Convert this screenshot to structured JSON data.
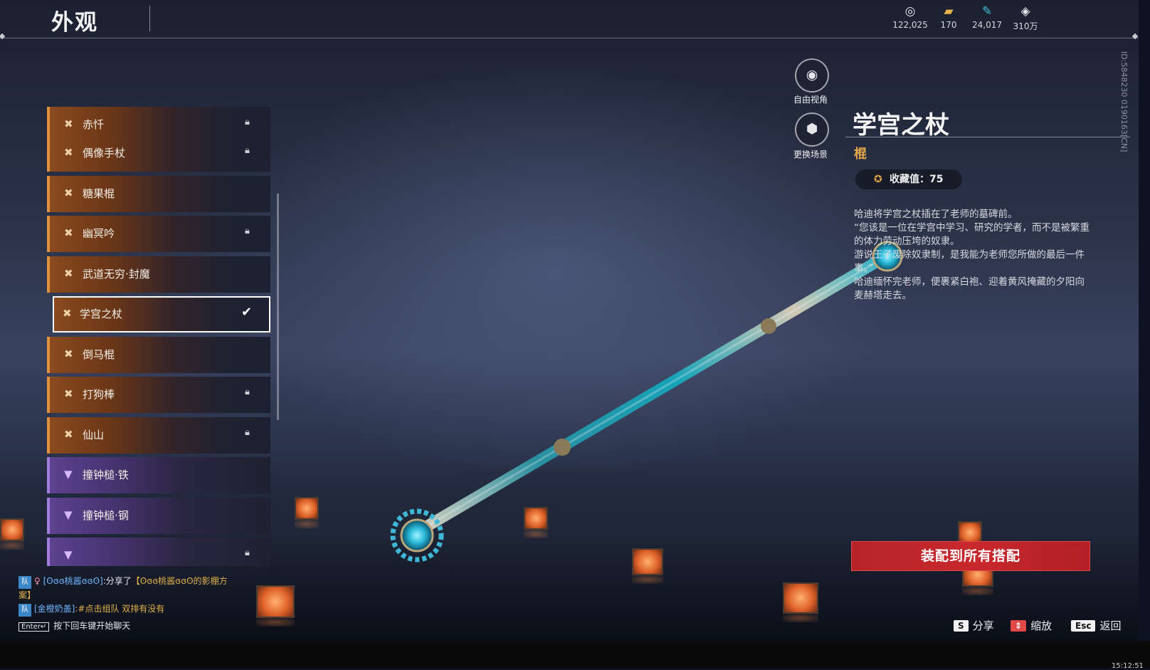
{
  "header": {
    "title": "外观"
  },
  "currencies": [
    {
      "icon": "coin-icon",
      "glyph": "◎",
      "value": "122,025",
      "color": "#d8d8de"
    },
    {
      "icon": "ticket-icon",
      "glyph": "▰",
      "value": "170",
      "color": "#e4b34a"
    },
    {
      "icon": "feather-icon",
      "glyph": "✎",
      "value": "24,017",
      "color": "#3fc2d8"
    },
    {
      "icon": "gem-icon",
      "glyph": "◈",
      "value": "310万",
      "color": "#f0f0f2"
    }
  ],
  "player_id": "ID:5848230 0190163[CN]",
  "list": {
    "items": [
      {
        "label": "赤忏",
        "locked": true,
        "tier": "orange",
        "selected": false
      },
      {
        "label": "偶像手杖",
        "locked": true,
        "tier": "orange",
        "selected": false
      },
      {
        "label": "糖果棍",
        "locked": false,
        "tier": "orange",
        "selected": false
      },
      {
        "label": "幽冥吟",
        "locked": true,
        "tier": "orange",
        "selected": false
      },
      {
        "label": "武道无穷·封魔",
        "locked": false,
        "tier": "orange",
        "selected": false
      },
      {
        "label": "学宫之杖",
        "locked": false,
        "tier": "orange",
        "selected": true
      },
      {
        "label": "倒马棍",
        "locked": false,
        "tier": "orange",
        "selected": false
      },
      {
        "label": "打狗棒",
        "locked": true,
        "tier": "orange",
        "selected": false
      },
      {
        "label": "仙山",
        "locked": true,
        "tier": "orange",
        "selected": false
      },
      {
        "label": "撞钟槌·铁",
        "locked": false,
        "tier": "purple",
        "selected": false
      },
      {
        "label": "撞钟槌·钢",
        "locked": false,
        "tier": "purple",
        "selected": false
      }
    ]
  },
  "camera": {
    "free_view_label": "自由视角",
    "change_scene_label": "更换场景"
  },
  "detail": {
    "name": "学宫之杖",
    "type": "棍",
    "collect_label": "收藏值：75",
    "description": [
      "哈迪将学宫之杖插在了老师的墓碑前。",
      "“您该是一位在学宫中学习、研究的学者，而不是被繁重的体力劳动压垮的奴隶。",
      "游说王子废除奴隶制，是我能为老师您所做的最后一件事。”",
      "哈迪缅怀完老师，便裹紧白袍、迎着黄风掩藏的夕阳向麦赫塔走去。"
    ],
    "equip_all_label": "装配到所有搭配"
  },
  "hints": [
    {
      "key": "S",
      "label": "分享"
    },
    {
      "key": "⇕",
      "label": "缩放"
    },
    {
      "key": "Esc",
      "label": "返回"
    }
  ],
  "chat": {
    "line1_tag": "队",
    "line1_name": "[ʘɞɞ桃酱ɞɞʘ]",
    "line1_text": ":分享了",
    "line1_link": "【ʘɞɞ桃酱ɞɞʘ的影棚方案】",
    "line2_tag": "队",
    "line2_name": "[金橙奶盖]",
    "line2_text": ":#点击组队 双排有没有",
    "enter_key": "Enter↵",
    "enter_hint": "按下回车键开始聊天"
  },
  "clock": "15:12:51"
}
